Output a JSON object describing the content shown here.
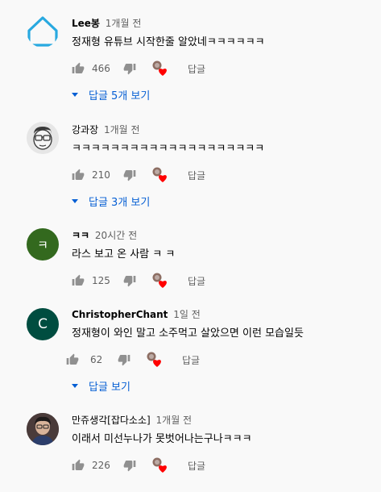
{
  "comments": [
    {
      "author": "Lee봉",
      "time": "1개월 전",
      "text": "정재형 유튜브 시작한줄 알았네ㅋㅋㅋㅋㅋㅋ",
      "likes": "466",
      "reply_label": "답글",
      "view_replies": "답글 5개 보기",
      "avatar": {
        "type": "house-icon",
        "color": "#29a9e0"
      }
    },
    {
      "author": "강과장",
      "time": "1개월 전",
      "text": "ㅋㅋㅋㅋㅋㅋㅋㅋㅋㅋㅋㅋㅋㅋㅋㅋㅋㅋㅋㅋ",
      "likes": "210",
      "reply_label": "답글",
      "view_replies": "답글 3개 보기",
      "avatar": {
        "type": "cartoon-face-icon",
        "color": "#e0e0e0"
      }
    },
    {
      "author": "ㅋㅋ",
      "time": "20시간 전",
      "text": "라스 보고 온 사람 ㅋ ㅋ",
      "likes": "125",
      "reply_label": "답글",
      "avatar": {
        "type": "letter",
        "letter": "ㅋ",
        "color": "#33691e"
      }
    },
    {
      "author": "ChristopherChant",
      "time": "1일 전",
      "text": "정재형이 와인 말고 소주먹고 살았으면 이런 모습일듯",
      "likes": "62",
      "reply_label": "답글",
      "view_replies": "답글 보기",
      "avatar": {
        "type": "letter",
        "letter": "C",
        "color": "#004d40"
      }
    },
    {
      "author": "만쥬생각[잡다소소]",
      "time": "1개월 전",
      "text": "이래서 미선누나가 못벗어나는구나ㅋㅋㅋ",
      "likes": "226",
      "reply_label": "답글",
      "avatar": {
        "type": "photo-avatar-icon",
        "color": "#3d2c2a"
      }
    }
  ],
  "colors": {
    "link": "#065fd4",
    "secondary": "#606060",
    "heart": "#ff0000"
  }
}
